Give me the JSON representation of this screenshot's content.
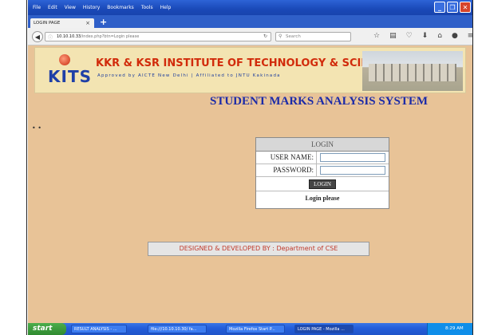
{
  "browser": {
    "menu": [
      "File",
      "Edit",
      "View",
      "History",
      "Bookmarks",
      "Tools",
      "Help"
    ],
    "tab_title": "LOGIN PAGE",
    "url_host": "10.10.10.33",
    "url_path": "/index.php?btn=Login please",
    "search_placeholder": "Search"
  },
  "header": {
    "logo_text": "KITS",
    "institute_name": "KKR & KSR INSTITUTE OF TECHNOLOGY & SCIENCES",
    "institute_subtitle": "Approved by AICTE New Delhi  |  Affiliated to JNTU Kakinada"
  },
  "page": {
    "system_title": "STUDENT MARKS ANALYSIS SYSTEM",
    "dots": "• •"
  },
  "login": {
    "heading": "LOGIN",
    "username_label": "USER NAME:",
    "password_label": "PASSWORD:",
    "username_value": "",
    "password_value": "",
    "button_label": "LOGIN",
    "message": "Login please"
  },
  "footer": {
    "credit": "DESIGNED & DEVELOPED BY : Department of CSE"
  },
  "taskbar": {
    "start_label": "start",
    "tasks": [
      "RESULT ANALYSIS - ...",
      "file:///10.10.10.30/ fa...",
      "Mozilla Firefox Start P...",
      "LOGIN PAGE - Mozilla ..."
    ],
    "clock": "8:29 AM"
  },
  "colors": {
    "page_bg": "#e8c397",
    "title_blue": "#1c2ba8",
    "institute_red": "#d12b0b",
    "credit_red": "#c0392b"
  }
}
